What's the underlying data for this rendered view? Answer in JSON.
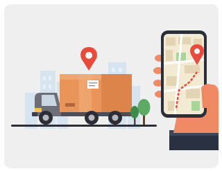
{
  "scene": {
    "background_color": "#efefef",
    "subjects": [
      "delivery-truck",
      "map-pin",
      "smartphone-map",
      "hand"
    ],
    "colors": {
      "pin": "#e84b3c",
      "box": "#e9955a",
      "truck_cab": "#6d6e78",
      "tree": "#4f9a57",
      "buildings": "#d9e6f0",
      "screen_map": "#f3ead4",
      "hand": "#f08a65",
      "sleeve": "#2a3140"
    }
  }
}
